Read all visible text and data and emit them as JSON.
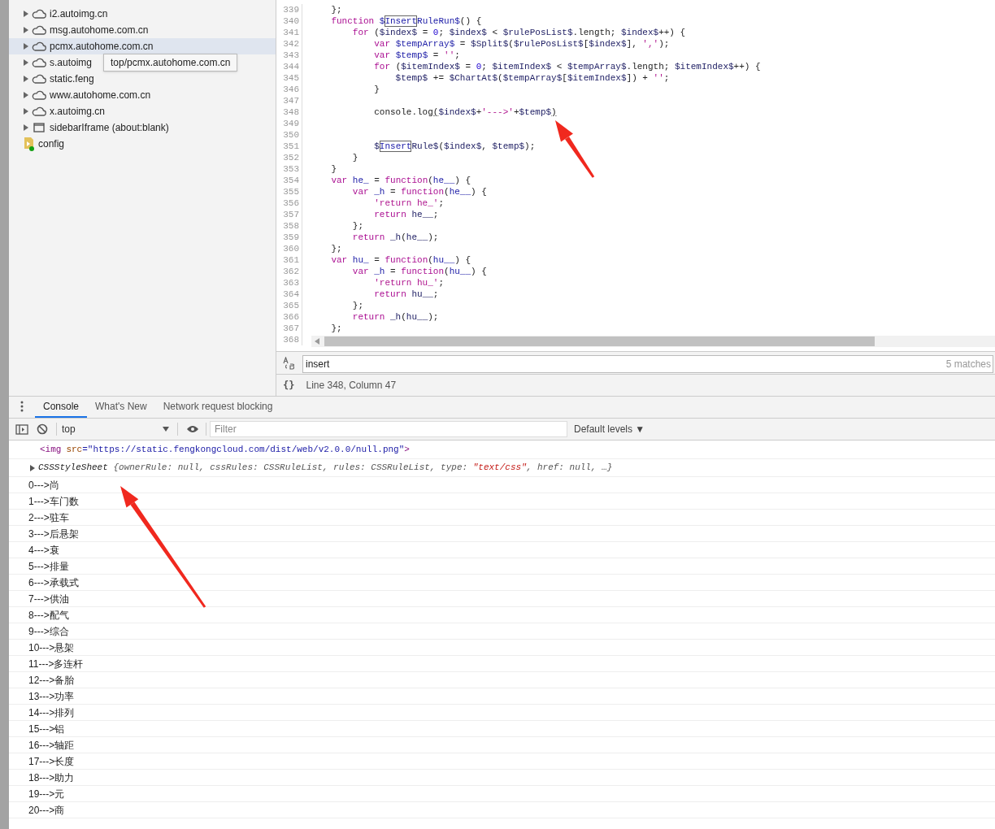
{
  "frames_tree": {
    "items": [
      {
        "label": "i2.autoimg.cn",
        "kind": "domain",
        "selected": false
      },
      {
        "label": "msg.autohome.com.cn",
        "kind": "domain",
        "selected": false
      },
      {
        "label": "pcmx.autohome.com.cn",
        "kind": "domain",
        "selected": true
      },
      {
        "label": "s.autoimg",
        "kind": "domain",
        "selected": false
      },
      {
        "label": "static.feng",
        "kind": "domain",
        "selected": false
      },
      {
        "label": "www.autohome.com.cn",
        "kind": "domain",
        "selected": false
      },
      {
        "label": "x.autoimg.cn",
        "kind": "domain",
        "selected": false
      },
      {
        "label": "sidebarIframe (about:blank)",
        "kind": "frame",
        "selected": false
      },
      {
        "label": "config",
        "kind": "file",
        "selected": false
      }
    ],
    "tooltip": "top/pcmx.autohome.com.cn"
  },
  "editor": {
    "lines": [
      {
        "n": "339",
        "code": [
          {
            "t": "    };",
            "kind": "plain"
          }
        ]
      },
      {
        "n": "340",
        "code": [
          {
            "t": "    function",
            "kind": "kw"
          },
          {
            "t": " $",
            "kind": "def"
          },
          {
            "t": "Insert",
            "kind": "match"
          },
          {
            "t": "RuleRun$",
            "kind": "def"
          },
          {
            "t": "() {",
            "kind": "plain"
          }
        ]
      },
      {
        "n": "341",
        "code": [
          {
            "t": "        for",
            "kind": "kw"
          },
          {
            "t": " (",
            "kind": "plain"
          },
          {
            "t": "$index$",
            "kind": "var"
          },
          {
            "t": " = ",
            "kind": "plain"
          },
          {
            "t": "0",
            "kind": "num"
          },
          {
            "t": "; ",
            "kind": "plain"
          },
          {
            "t": "$index$",
            "kind": "var"
          },
          {
            "t": " < ",
            "kind": "plain"
          },
          {
            "t": "$rulePosList$",
            "kind": "var"
          },
          {
            "t": ".length; ",
            "kind": "plain"
          },
          {
            "t": "$index$",
            "kind": "var"
          },
          {
            "t": "++) {",
            "kind": "plain"
          }
        ]
      },
      {
        "n": "342",
        "code": [
          {
            "t": "            var",
            "kind": "kw"
          },
          {
            "t": " $tempArray$",
            "kind": "def"
          },
          {
            "t": " = ",
            "kind": "plain"
          },
          {
            "t": "$Split$",
            "kind": "var"
          },
          {
            "t": "(",
            "kind": "plain"
          },
          {
            "t": "$rulePosList$",
            "kind": "var"
          },
          {
            "t": "[",
            "kind": "plain"
          },
          {
            "t": "$index$",
            "kind": "var"
          },
          {
            "t": "], ",
            "kind": "plain"
          },
          {
            "t": "','",
            "kind": "str"
          },
          {
            "t": ");",
            "kind": "plain"
          }
        ]
      },
      {
        "n": "343",
        "code": [
          {
            "t": "            var",
            "kind": "kw"
          },
          {
            "t": " $temp$",
            "kind": "def"
          },
          {
            "t": " = ",
            "kind": "plain"
          },
          {
            "t": "''",
            "kind": "str"
          },
          {
            "t": ";",
            "kind": "plain"
          }
        ]
      },
      {
        "n": "344",
        "code": [
          {
            "t": "            for",
            "kind": "kw"
          },
          {
            "t": " (",
            "kind": "plain"
          },
          {
            "t": "$itemIndex$",
            "kind": "var"
          },
          {
            "t": " = ",
            "kind": "plain"
          },
          {
            "t": "0",
            "kind": "num"
          },
          {
            "t": "; ",
            "kind": "plain"
          },
          {
            "t": "$itemIndex$",
            "kind": "var"
          },
          {
            "t": " < ",
            "kind": "plain"
          },
          {
            "t": "$tempArray$",
            "kind": "var"
          },
          {
            "t": ".length; ",
            "kind": "plain"
          },
          {
            "t": "$itemIndex$",
            "kind": "var"
          },
          {
            "t": "++) {",
            "kind": "plain"
          }
        ]
      },
      {
        "n": "345",
        "code": [
          {
            "t": "                $temp$",
            "kind": "var"
          },
          {
            "t": " += ",
            "kind": "plain"
          },
          {
            "t": "$ChartAt$",
            "kind": "var"
          },
          {
            "t": "(",
            "kind": "plain"
          },
          {
            "t": "$tempArray$",
            "kind": "var"
          },
          {
            "t": "[",
            "kind": "plain"
          },
          {
            "t": "$itemIndex$",
            "kind": "var"
          },
          {
            "t": "]) + ",
            "kind": "plain"
          },
          {
            "t": "''",
            "kind": "str"
          },
          {
            "t": ";",
            "kind": "plain"
          }
        ]
      },
      {
        "n": "346",
        "code": [
          {
            "t": "            }",
            "kind": "plain"
          }
        ]
      },
      {
        "n": "347"
      },
      {
        "n": "348",
        "code": [
          {
            "t": "            console.log",
            "kind": "plain"
          },
          {
            "t": "(",
            "kind": "bracket"
          },
          {
            "t": "$index$",
            "kind": "var"
          },
          {
            "t": "+",
            "kind": "plain"
          },
          {
            "t": "'--->'",
            "kind": "str"
          },
          {
            "t": "+",
            "kind": "plain"
          },
          {
            "t": "$temp$",
            "kind": "var"
          },
          {
            "t": ")",
            "kind": "bracket"
          }
        ]
      },
      {
        "n": "349"
      },
      {
        "n": "350"
      },
      {
        "n": "351",
        "code": [
          {
            "t": "            $",
            "kind": "var"
          },
          {
            "t": "Insert",
            "kind": "match"
          },
          {
            "t": "Rule$",
            "kind": "var"
          },
          {
            "t": "(",
            "kind": "plain"
          },
          {
            "t": "$index$",
            "kind": "var"
          },
          {
            "t": ", ",
            "kind": "plain"
          },
          {
            "t": "$temp$",
            "kind": "var"
          },
          {
            "t": ");",
            "kind": "plain"
          }
        ]
      },
      {
        "n": "352",
        "code": [
          {
            "t": "        }",
            "kind": "plain"
          }
        ]
      },
      {
        "n": "353",
        "code": [
          {
            "t": "    }",
            "kind": "plain"
          }
        ]
      },
      {
        "n": "354",
        "code": [
          {
            "t": "    var",
            "kind": "kw"
          },
          {
            "t": " he_",
            "kind": "def"
          },
          {
            "t": " = ",
            "kind": "plain"
          },
          {
            "t": "function",
            "kind": "kw"
          },
          {
            "t": "(",
            "kind": "plain"
          },
          {
            "t": "he__",
            "kind": "def"
          },
          {
            "t": ") {",
            "kind": "plain"
          }
        ]
      },
      {
        "n": "355",
        "code": [
          {
            "t": "        var",
            "kind": "kw"
          },
          {
            "t": " _h",
            "kind": "def"
          },
          {
            "t": " = ",
            "kind": "plain"
          },
          {
            "t": "function",
            "kind": "kw"
          },
          {
            "t": "(",
            "kind": "plain"
          },
          {
            "t": "he__",
            "kind": "def"
          },
          {
            "t": ") {",
            "kind": "plain"
          }
        ]
      },
      {
        "n": "356",
        "code": [
          {
            "t": "            'return he_'",
            "kind": "str"
          },
          {
            "t": ";",
            "kind": "plain"
          }
        ]
      },
      {
        "n": "357",
        "code": [
          {
            "t": "            return",
            "kind": "kw"
          },
          {
            "t": " he__",
            "kind": "var"
          },
          {
            "t": ";",
            "kind": "plain"
          }
        ]
      },
      {
        "n": "358",
        "code": [
          {
            "t": "        };",
            "kind": "plain"
          }
        ]
      },
      {
        "n": "359",
        "code": [
          {
            "t": "        return",
            "kind": "kw"
          },
          {
            "t": " _h",
            "kind": "var"
          },
          {
            "t": "(",
            "kind": "plain"
          },
          {
            "t": "he__",
            "kind": "var"
          },
          {
            "t": ");",
            "kind": "plain"
          }
        ]
      },
      {
        "n": "360",
        "code": [
          {
            "t": "    };",
            "kind": "plain"
          }
        ]
      },
      {
        "n": "361",
        "code": [
          {
            "t": "    var",
            "kind": "kw"
          },
          {
            "t": " hu_",
            "kind": "def"
          },
          {
            "t": " = ",
            "kind": "plain"
          },
          {
            "t": "function",
            "kind": "kw"
          },
          {
            "t": "(",
            "kind": "plain"
          },
          {
            "t": "hu__",
            "kind": "def"
          },
          {
            "t": ") {",
            "kind": "plain"
          }
        ]
      },
      {
        "n": "362",
        "code": [
          {
            "t": "        var",
            "kind": "kw"
          },
          {
            "t": " _h",
            "kind": "def"
          },
          {
            "t": " = ",
            "kind": "plain"
          },
          {
            "t": "function",
            "kind": "kw"
          },
          {
            "t": "(",
            "kind": "plain"
          },
          {
            "t": "hu__",
            "kind": "def"
          },
          {
            "t": ") {",
            "kind": "plain"
          }
        ]
      },
      {
        "n": "363",
        "code": [
          {
            "t": "            'return hu_'",
            "kind": "str"
          },
          {
            "t": ";",
            "kind": "plain"
          }
        ]
      },
      {
        "n": "364",
        "code": [
          {
            "t": "            return",
            "kind": "kw"
          },
          {
            "t": " hu__",
            "kind": "var"
          },
          {
            "t": ";",
            "kind": "plain"
          }
        ]
      },
      {
        "n": "365",
        "code": [
          {
            "t": "        };",
            "kind": "plain"
          }
        ]
      },
      {
        "n": "366",
        "code": [
          {
            "t": "        return",
            "kind": "kw"
          },
          {
            "t": " _h",
            "kind": "var"
          },
          {
            "t": "(",
            "kind": "plain"
          },
          {
            "t": "hu__",
            "kind": "var"
          },
          {
            "t": ");",
            "kind": "plain"
          }
        ]
      },
      {
        "n": "367",
        "code": [
          {
            "t": "    };",
            "kind": "plain"
          }
        ]
      },
      {
        "n": "368"
      }
    ],
    "search": {
      "value": "insert",
      "matches": "5 matches"
    },
    "format_button": "{}",
    "status": "Line 348, Column 47"
  },
  "drawer": {
    "tabs": [
      {
        "label": "Console",
        "selected": true
      },
      {
        "label": "What's New",
        "selected": false
      },
      {
        "label": "Network request blocking",
        "selected": false
      }
    ],
    "context": "top",
    "filter": {
      "placeholder": "Filter"
    },
    "levels": "Default levels ▼"
  },
  "console": {
    "element": [
      {
        "t": "<img",
        "kind": "tag"
      },
      {
        "t": "src",
        "kind": "attr"
      },
      {
        "t": "=\"https://static.fengkongcloud.com/dist/web/v2.0.0/null.png\"",
        "kind": "value"
      },
      {
        "t": ">",
        "kind": "tag"
      }
    ],
    "object": {
      "name": "CSSStyleSheet",
      "preview": [
        {
          "t": "{ownerRule: null, cssRules: CSSRuleList, rules: CSSRuleList, type: ",
          "kind": "plain"
        },
        {
          "t": "\"text/css\"",
          "kind": "str"
        },
        {
          "t": ", href: null, …}",
          "kind": "plain"
        }
      ]
    },
    "logs": [
      "0--->尚",
      "1--->车门数",
      "2--->驻车",
      "3--->后悬架",
      "4--->衰",
      "5--->排量",
      "6--->承载式",
      "7--->供油",
      "8--->配气",
      "9--->综合",
      "10--->悬架",
      "11--->多连杆",
      "12--->备胎",
      "13--->功率",
      "14--->排列",
      "15--->铝",
      "16--->轴距",
      "17--->长度",
      "18--->助力",
      "19--->元",
      "20--->商"
    ]
  }
}
